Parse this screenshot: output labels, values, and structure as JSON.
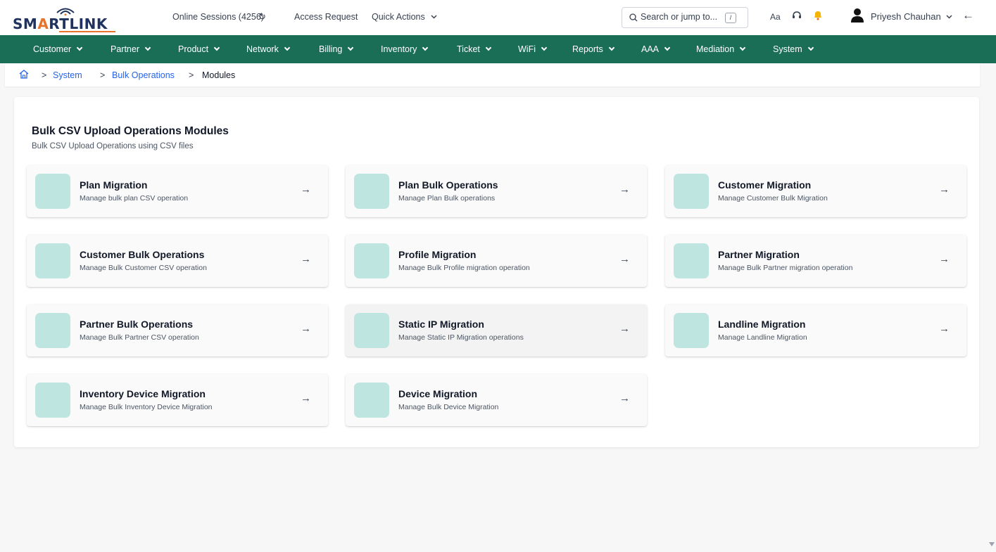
{
  "brand": {
    "logo_text_a": "SM",
    "logo_text_b": "A",
    "logo_text_c": "RTLINK",
    "accent": "#e8742b",
    "primary": "#20325e"
  },
  "header": {
    "online_sessions": "Online Sessions (4256)",
    "access_request": "Access Request",
    "quick_actions": "Quick Actions",
    "search_placeholder": "Search or jump to...",
    "search_key": "/",
    "font_toggle": "Aa",
    "user_name": "Priyesh Chauhan"
  },
  "nav": {
    "color": "#1a6e55",
    "items": [
      "Customer",
      "Partner",
      "Product",
      "Network",
      "Billing",
      "Inventory",
      "Ticket",
      "WiFi",
      "Reports",
      "AAA",
      "Mediation",
      "System"
    ]
  },
  "breadcrumb": {
    "items": [
      "System",
      "Bulk Operations",
      "Modules"
    ],
    "separator": ">"
  },
  "section": {
    "title": "Bulk CSV Upload Operations Modules",
    "subtitle": "Bulk CSV Upload Operations using CSV files"
  },
  "modules": [
    {
      "title": "Plan Migration",
      "desc": "Manage bulk plan CSV operation"
    },
    {
      "title": "Plan Bulk Operations",
      "desc": "Manage Plan Bulk operations"
    },
    {
      "title": "Customer Migration",
      "desc": "Manage Customer Bulk Migration"
    },
    {
      "title": "Customer Bulk Operations",
      "desc": "Manage Bulk Customer CSV operation"
    },
    {
      "title": "Profile Migration",
      "desc": "Manage Bulk Profile migration operation"
    },
    {
      "title": "Partner Migration",
      "desc": "Manage Bulk Partner migration operation"
    },
    {
      "title": "Partner Bulk Operations",
      "desc": "Manage Bulk Partner CSV operation"
    },
    {
      "title": "Static IP Migration",
      "desc": "Manage Static IP Migration operations"
    },
    {
      "title": "Landline Migration",
      "desc": "Manage Landline Migration"
    },
    {
      "title": "Inventory Device Migration",
      "desc": "Manage Bulk Inventory Device Migration"
    },
    {
      "title": "Device Migration",
      "desc": "Manage Bulk Device Migration"
    }
  ],
  "icons": {
    "arrow": "→",
    "refresh": "↻",
    "search": "⌕",
    "chevron": "⌄",
    "back": "←",
    "home": "home-icon"
  }
}
